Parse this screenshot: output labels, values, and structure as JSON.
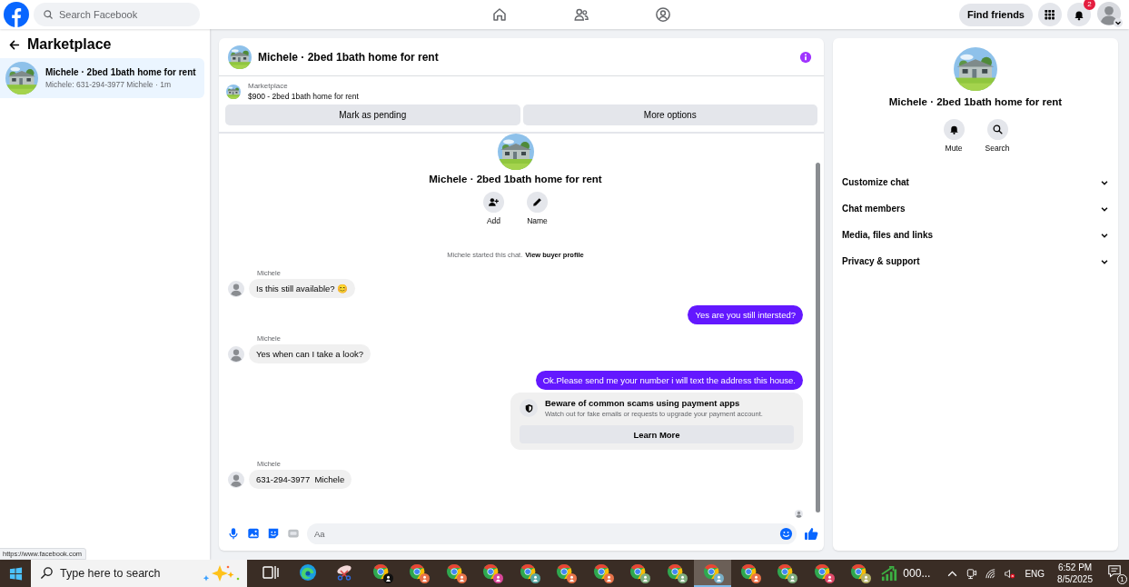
{
  "topbar": {
    "search": {
      "placeholder": "Search Facebook"
    },
    "nav": [
      {
        "kind": "home",
        "selected": false
      },
      {
        "kind": "friends",
        "selected": false
      },
      {
        "kind": "profile",
        "selected": false
      }
    ],
    "find_friends": "Find friends",
    "notifications_badge": "2"
  },
  "sidebar": {
    "title": "Marketplace",
    "conversations": [
      {
        "title": "Michele · 2bed 1bath home for rent",
        "preview": "Michele: 631-294-3977 Michele · 1m",
        "selected": true
      }
    ]
  },
  "chat": {
    "title": "Michele · 2bed 1bath home for rent",
    "listing": {
      "label": "Marketplace",
      "detail": "$900 - 2bed 1bath home for rent"
    },
    "listing_buttons": [
      "Mark as pending",
      "More options"
    ],
    "intro": {
      "title": "Michele · 2bed 1bath home for rent",
      "actions": [
        {
          "kind": "add",
          "label": "Add"
        },
        {
          "kind": "name",
          "label": "Name"
        }
      ],
      "notice": "Michele started this chat.",
      "notice_link": "View buyer profile"
    },
    "messages": [
      {
        "kind": "incoming",
        "sender": "Michele",
        "text": "Is this still available? 😊"
      },
      {
        "kind": "outgoing",
        "text": "Yes are you still intersted?"
      },
      {
        "kind": "incoming",
        "sender": "Michele",
        "text": "Yes when can I take a look?"
      },
      {
        "kind": "outgoing",
        "text": "Ok.Please send me your number i will text the address this house."
      },
      {
        "kind": "warning",
        "title": "Beware of common scams using payment apps",
        "body": "Watch out for fake emails or requests to upgrade your payment account.",
        "button": "Learn More"
      },
      {
        "kind": "incoming",
        "sender": "Michele",
        "text": "631-294-3977  Michele"
      }
    ],
    "composer": {
      "placeholder": "Aa"
    }
  },
  "details": {
    "title": "Michele · 2bed 1bath home for rent",
    "actions": [
      {
        "kind": "mute",
        "label": "Mute"
      },
      {
        "kind": "search",
        "label": "Search"
      }
    ],
    "sections": [
      {
        "label": "Customize chat",
        "expanded": false
      },
      {
        "label": "Chat members",
        "expanded": false
      },
      {
        "label": "Media, files and links",
        "expanded": false
      },
      {
        "label": "Privacy & support",
        "expanded": false
      }
    ]
  },
  "status_url": "https://www.facebook.com",
  "taskbar": {
    "search_placeholder": "Type here to search",
    "apps": [
      {
        "kind": "taskview",
        "selected": false
      },
      {
        "kind": "edge",
        "selected": false
      },
      {
        "kind": "snip",
        "selected": false
      },
      {
        "kind": "chrome",
        "color": "#111111",
        "selected": false
      },
      {
        "kind": "chrome",
        "color": "#e8734a",
        "selected": false
      },
      {
        "kind": "chrome",
        "color": "#e8734a",
        "selected": false
      },
      {
        "kind": "chrome",
        "color": "#d9489a",
        "selected": false
      },
      {
        "kind": "chrome",
        "color": "#5aa6a0",
        "selected": false
      },
      {
        "kind": "chrome",
        "color": "#e8734a",
        "selected": false
      },
      {
        "kind": "chrome",
        "color": "#e8734a",
        "selected": false
      },
      {
        "kind": "chrome",
        "color": "#7fae7f",
        "selected": false
      },
      {
        "kind": "chrome",
        "color": "#7fae7f",
        "selected": false
      },
      {
        "kind": "chrome",
        "color": "#7ab0c8",
        "selected": true
      },
      {
        "kind": "chrome",
        "color": "#e8734a",
        "selected": false
      },
      {
        "kind": "chrome",
        "color": "#7fae7f",
        "selected": false
      },
      {
        "kind": "chrome",
        "color": "#e04a6a",
        "selected": false
      },
      {
        "kind": "chrome",
        "color": "#b5b36a",
        "selected": false
      }
    ],
    "stocks": "000...",
    "language": "ENG",
    "time": "6:52 PM",
    "date": "8/5/2025",
    "notification_count": "1"
  }
}
